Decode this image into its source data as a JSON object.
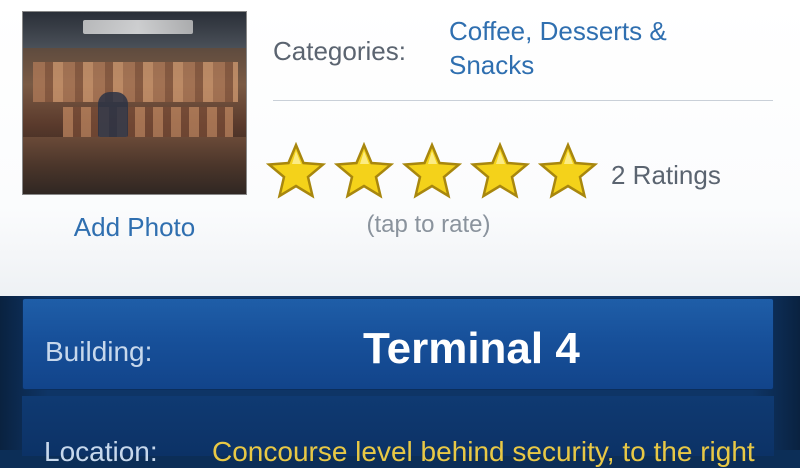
{
  "photo": {
    "add_photo_label": "Add Photo"
  },
  "details": {
    "categories_label": "Categories:",
    "categories_value": "Coffee, Desserts & Snacks"
  },
  "rating": {
    "stars_filled": 5,
    "stars_total": 5,
    "ratings_count": "2 Ratings",
    "hint": "(tap to rate)",
    "star_color": "#f4d21a"
  },
  "info": {
    "building_label": "Building:",
    "building_value": "Terminal 4",
    "location_label": "Location:",
    "location_value": "Concourse level behind security, to the right"
  },
  "colors": {
    "link": "#2f6fb0",
    "panel_blue": "#17509a",
    "highlight_yellow": "#e8c845"
  }
}
